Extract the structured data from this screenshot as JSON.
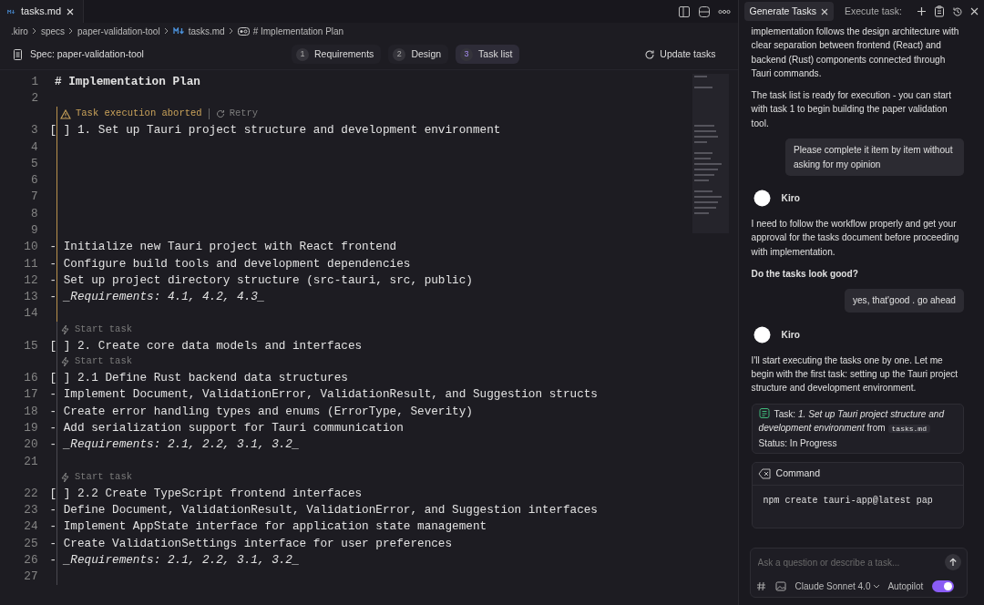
{
  "editor_tab": {
    "label": "tasks.md"
  },
  "breadcrumb": [
    {
      "label": ".kiro",
      "kind": "folder"
    },
    {
      "label": "specs",
      "kind": "folder"
    },
    {
      "label": "paper-validation-tool",
      "kind": "folder"
    },
    {
      "label": "tasks.md",
      "kind": "markdown"
    },
    {
      "label": "# Implementation Plan",
      "kind": "symbol"
    }
  ],
  "spec_bar": {
    "label": "Spec: paper-validation-tool",
    "update": "Update tasks",
    "steps": [
      {
        "number": "1",
        "label": "Requirements",
        "selected": false
      },
      {
        "number": "2",
        "label": "Design",
        "selected": false
      },
      {
        "number": "3",
        "label": "Task list",
        "selected": true
      }
    ]
  },
  "editor": {
    "blocks": [
      {
        "kind": "plain",
        "lines": [
          {
            "number": "1",
            "kind": "heading",
            "text": "# Implementation Plan"
          },
          {
            "number": "2",
            "kind": "blank"
          }
        ]
      },
      {
        "kind": "aborted",
        "lens": {
          "label": "Task execution aborted",
          "action": "Retry"
        },
        "lines": [
          {
            "number": "3",
            "kind": "task",
            "text": "[ ] 1. Set up Tauri project structure and development environment"
          },
          {
            "number": "4",
            "kind": "blank"
          },
          {
            "number": "5",
            "kind": "blank"
          },
          {
            "number": "6",
            "kind": "blank"
          },
          {
            "number": "7",
            "kind": "blank"
          },
          {
            "number": "8",
            "kind": "blank"
          },
          {
            "number": "9",
            "kind": "blank"
          },
          {
            "number": "10",
            "kind": "item",
            "text": "- Initialize new Tauri project with React frontend"
          },
          {
            "number": "11",
            "kind": "item",
            "text": "- Configure build tools and development dependencies"
          },
          {
            "number": "12",
            "kind": "item",
            "text": "- Set up project directory structure (src-tauri, src, public)"
          },
          {
            "number": "13",
            "kind": "req",
            "text": "- *_Requirements: 4.1, 4.2, 4.3_*"
          },
          {
            "number": "14",
            "kind": "blank"
          }
        ]
      },
      {
        "kind": "pending",
        "lens": {
          "label": "Start task"
        },
        "lines": [
          {
            "number": "15",
            "kind": "task",
            "text": "[ ] 2. Create core data models and interfaces"
          }
        ]
      },
      {
        "kind": "pending",
        "lens": {
          "label": "Start task"
        },
        "lines": [
          {
            "number": "16",
            "kind": "task",
            "text": "[ ] 2.1 Define Rust backend data structures"
          },
          {
            "number": "17",
            "kind": "item",
            "text": "- Implement Document, ValidationError, ValidationResult, and Suggestion structs"
          },
          {
            "number": "18",
            "kind": "item",
            "text": "- Create error handling types and enums (ErrorType, Severity)"
          },
          {
            "number": "19",
            "kind": "item",
            "text": "- Add serialization support for Tauri communication"
          },
          {
            "number": "20",
            "kind": "req",
            "text": "- *_Requirements: 2.1, 2.2, 3.1, 3.2_*"
          },
          {
            "number": "21",
            "kind": "blank"
          }
        ]
      },
      {
        "kind": "pending",
        "lens": {
          "label": "Start task"
        },
        "lines": [
          {
            "number": "22",
            "kind": "task",
            "text": "[ ] 2.2 Create TypeScript frontend interfaces"
          },
          {
            "number": "23",
            "kind": "item",
            "text": "- Define Document, ValidationResult, ValidationError, and Suggestion interfaces"
          },
          {
            "number": "24",
            "kind": "item",
            "text": "- Implement AppState interface for application state management"
          },
          {
            "number": "25",
            "kind": "item",
            "text": "- Create ValidationSettings interface for user preferences"
          },
          {
            "number": "26",
            "kind": "req",
            "text": "- *_Requirements: 2.1, 2.2, 3.1, 3.2_*"
          },
          {
            "number": "27",
            "kind": "blank"
          }
        ]
      }
    ]
  },
  "chat": {
    "tabs": [
      {
        "label": "Generate Tasks",
        "selected": true
      },
      {
        "label": "Execute task:",
        "selected": false
      }
    ],
    "messages": [
      {
        "kind": "text",
        "text": "implementation follows the design architecture with clear separation between frontend (React) and backend (Rust) components connected through Tauri commands."
      },
      {
        "kind": "text",
        "text": "The task list is ready for execution - you can start with task 1 to begin building the paper validation tool."
      },
      {
        "kind": "user",
        "text": "Please complete it item by item without asking for my opinion"
      },
      {
        "kind": "agent",
        "text": "Kiro"
      },
      {
        "kind": "text",
        "text": "I need to follow the workflow properly and get your approval for the tasks document before proceeding with implementation."
      },
      {
        "kind": "bold",
        "text": "Do the tasks look good?"
      },
      {
        "kind": "user",
        "text": "yes, that'good . go ahead"
      },
      {
        "kind": "agent",
        "text": "Kiro"
      },
      {
        "kind": "text",
        "text": "I'll start executing the tasks one by one. Let me begin with the first task: setting up the Tauri project structure and development environment."
      },
      {
        "kind": "task",
        "text": "Task: *1. Set up Tauri project structure and development environment* from",
        "file": "tasks.md",
        "status": "Status: In Progress"
      },
      {
        "kind": "command",
        "title": "Command",
        "code": "npm create tauri-app@latest pap"
      }
    ],
    "input": {
      "placeholder": "Ask a question or describe a task...",
      "model": "Claude Sonnet 4.0",
      "autopilot": {
        "label": "Autopilot",
        "on": true
      }
    }
  }
}
